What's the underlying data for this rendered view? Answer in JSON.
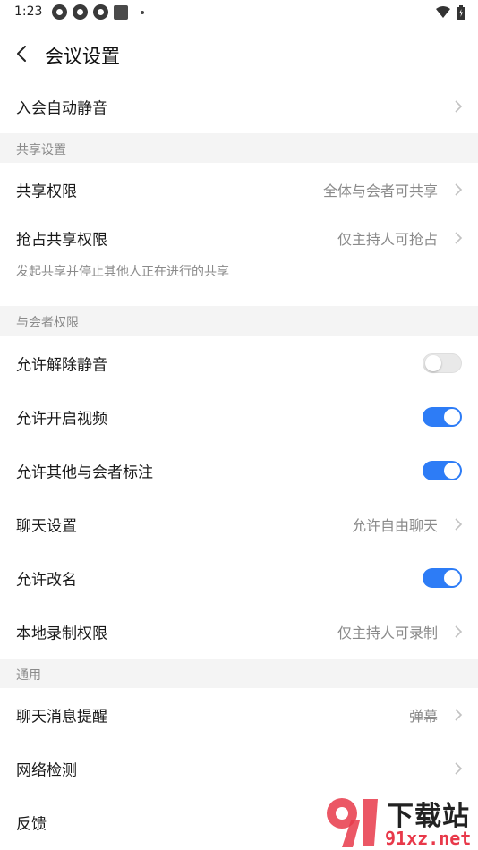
{
  "status_bar": {
    "time": "1:23"
  },
  "header": {
    "title": "会议设置"
  },
  "rows_top": [
    {
      "label": "入会自动静音"
    }
  ],
  "sections": {
    "share": "共享设置",
    "attendee": "与会者权限",
    "general": "通用"
  },
  "share": {
    "share_permission": {
      "label": "共享权限",
      "value": "全体与会者可共享"
    },
    "grab_permission": {
      "label": "抢占共享权限",
      "value": "仅主持人可抢占"
    },
    "hint": "发起共享并停止其他人正在进行的共享"
  },
  "attendee": {
    "unmute": {
      "label": "允许解除静音",
      "on": false
    },
    "video": {
      "label": "允许开启视频",
      "on": true
    },
    "annotate": {
      "label": "允许其他与会者标注",
      "on": true
    },
    "chat": {
      "label": "聊天设置",
      "value": "允许自由聊天"
    },
    "rename": {
      "label": "允许改名",
      "on": true
    },
    "record": {
      "label": "本地录制权限",
      "value": "仅主持人可录制"
    }
  },
  "general": {
    "chat_notify": {
      "label": "聊天消息提醒",
      "value": "弹幕"
    },
    "network": {
      "label": "网络检测"
    },
    "feedback": {
      "label": "反馈"
    }
  },
  "watermark": {
    "text": "下载站",
    "url": "91xz.net"
  },
  "colors": {
    "accent": "#2d7cf6",
    "section_bg": "#f4f4f4",
    "muted_text": "#8a8a8a"
  }
}
